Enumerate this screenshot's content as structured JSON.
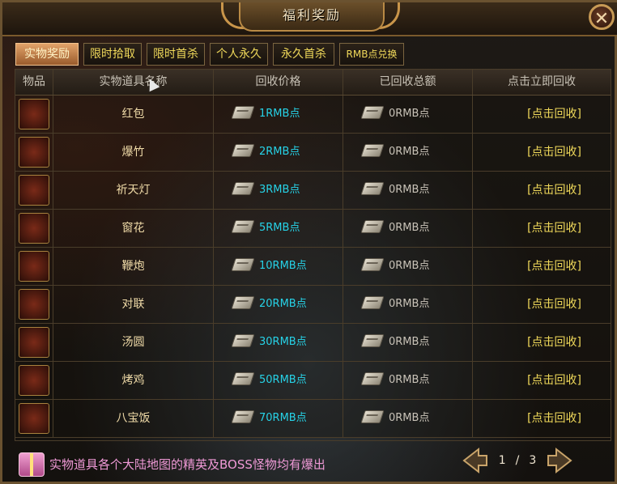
{
  "window": {
    "title": "福利奖励",
    "close_label": "✕"
  },
  "tabs": [
    {
      "label": "实物奖励",
      "active": true
    },
    {
      "label": "限时拾取",
      "active": false
    },
    {
      "label": "限时首杀",
      "active": false
    },
    {
      "label": "个人永久",
      "active": false
    },
    {
      "label": "永久首杀",
      "active": false
    },
    {
      "label": "RMB点兑换",
      "active": false
    }
  ],
  "table": {
    "headers": [
      "物品",
      "实物道具名称",
      "回收价格",
      "已回收总额",
      "点击立即回收"
    ],
    "rows": [
      {
        "icon": "red-envelope-icon",
        "name": "红包",
        "price": "1RMB点",
        "total": "0RMB点",
        "action": "[点击回收]"
      },
      {
        "icon": "firecracker-icon",
        "name": "爆竹",
        "price": "2RMB点",
        "total": "0RMB点",
        "action": "[点击回收]"
      },
      {
        "icon": "sky-lantern-icon",
        "name": "祈天灯",
        "price": "3RMB点",
        "total": "0RMB点",
        "action": "[点击回收]"
      },
      {
        "icon": "paper-cut-icon",
        "name": "窗花",
        "price": "5RMB点",
        "total": "0RMB点",
        "action": "[点击回收]"
      },
      {
        "icon": "firework-icon",
        "name": "鞭炮",
        "price": "10RMB点",
        "total": "0RMB点",
        "action": "[点击回收]"
      },
      {
        "icon": "couplet-icon",
        "name": "对联",
        "price": "20RMB点",
        "total": "0RMB点",
        "action": "[点击回收]"
      },
      {
        "icon": "tangyuan-icon",
        "name": "汤圆",
        "price": "30RMB点",
        "total": "0RMB点",
        "action": "[点击回收]"
      },
      {
        "icon": "roast-chicken-icon",
        "name": "烤鸡",
        "price": "50RMB点",
        "total": "0RMB点",
        "action": "[点击回收]"
      },
      {
        "icon": "eight-treasure-rice-icon",
        "name": "八宝饭",
        "price": "70RMB点",
        "total": "0RMB点",
        "action": "[点击回收]"
      }
    ]
  },
  "footer": {
    "icon": "gift-box-icon",
    "text": "实物道具各个大陆地图的精英及BOSS怪物均有爆出"
  },
  "pager": {
    "current": "1",
    "separator": "/",
    "total": "3"
  },
  "colors": {
    "accent_gold": "#f0d95a",
    "price_cyan": "#26d3e8",
    "footer_pink": "#f09ad7"
  }
}
